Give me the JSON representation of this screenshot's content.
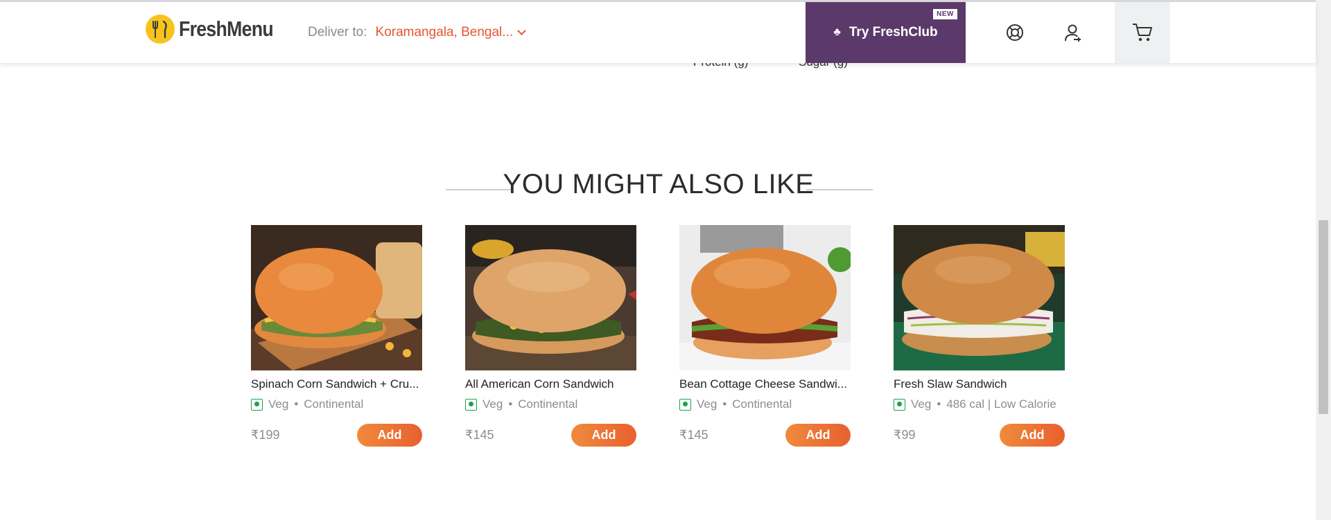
{
  "header": {
    "logo_text": "FreshMenu",
    "deliver_label": "Deliver to:",
    "deliver_location": "Koramangala, Bengal...",
    "freshclub_label": "Try FreshClub",
    "new_badge": "NEW",
    "icons": [
      "help-icon",
      "user-icon",
      "cart-icon"
    ]
  },
  "remnant": {
    "protein": "Protein (g)",
    "sugar": "Sugar (g)"
  },
  "section": {
    "title": "YOU MIGHT ALSO LIKE",
    "items": [
      {
        "name": "Spinach Corn Sandwich + Cru...",
        "veg_label": "Veg",
        "tag": "Continental",
        "price": "₹199",
        "add_label": "Add"
      },
      {
        "name": "All American Corn Sandwich",
        "veg_label": "Veg",
        "tag": "Continental",
        "price": "₹145",
        "add_label": "Add"
      },
      {
        "name": "Bean Cottage Cheese Sandwi...",
        "veg_label": "Veg",
        "tag": "Continental",
        "price": "₹145",
        "add_label": "Add"
      },
      {
        "name": "Fresh Slaw Sandwich",
        "veg_label": "Veg",
        "tag": "486 cal | Low Calorie",
        "price": "₹99",
        "add_label": "Add"
      }
    ]
  },
  "colors": {
    "accent": "#e4572e",
    "freshclub_bg": "#5b3a6b",
    "veg_green": "#1aa34a",
    "add_button": "#ec6f35"
  }
}
